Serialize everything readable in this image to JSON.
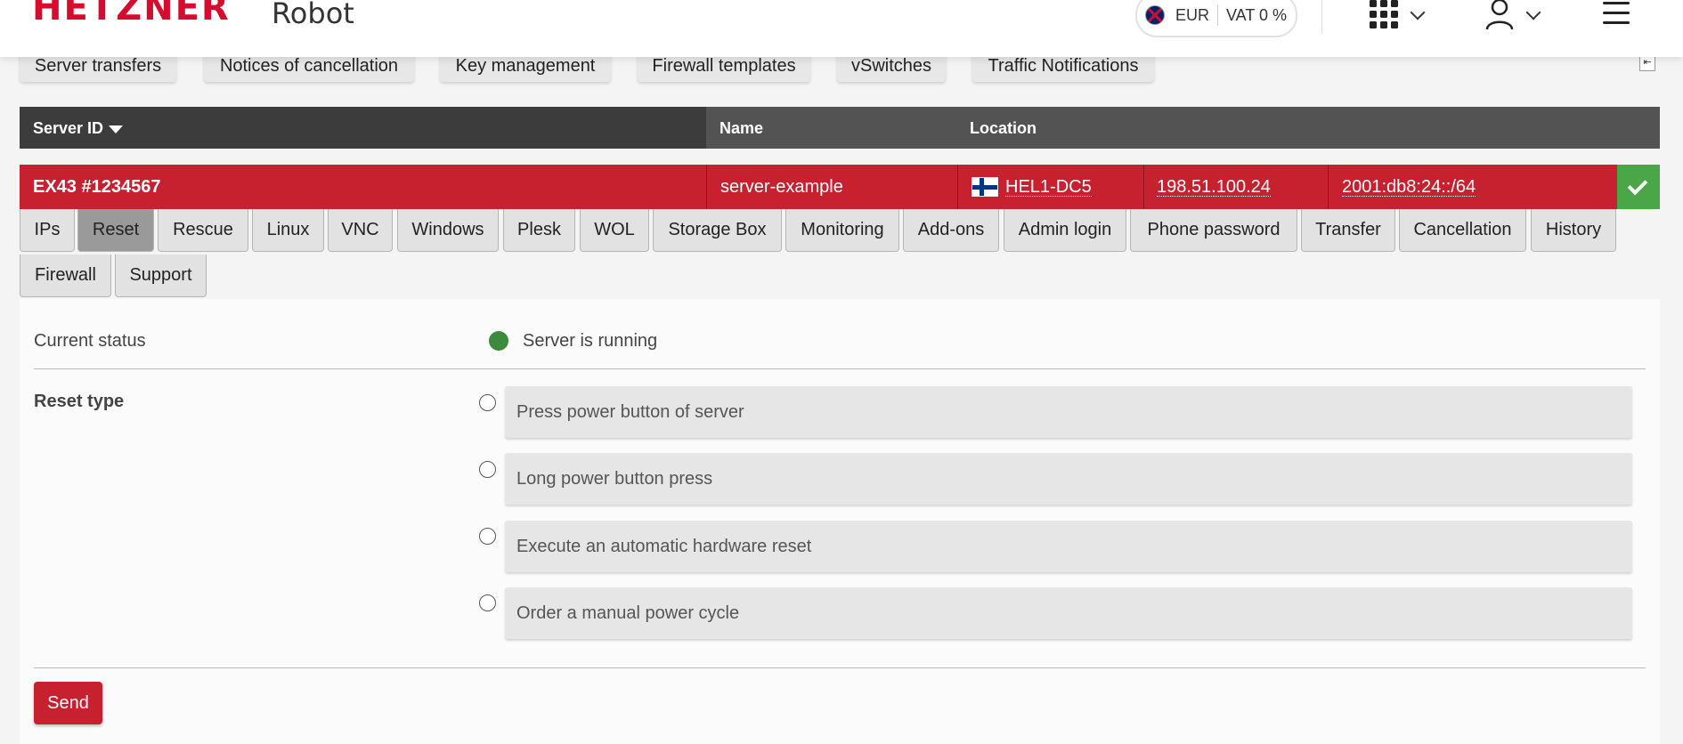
{
  "header": {
    "brand": "HETZNER",
    "product": "Robot",
    "currency": "EUR",
    "vat": "VAT 0 %",
    "locale_icon": "uk-flag-icon",
    "apps_icon": "grid-apps-icon",
    "user_icon": "user-icon",
    "menu_icon": "hamburger-menu-icon",
    "brand_color": "#d50c2d"
  },
  "subnav": {
    "items": [
      "Server transfers",
      "Notices of cancellation",
      "Key management",
      "Firewall templates",
      "vSwitches",
      "Traffic Notifications"
    ]
  },
  "table": {
    "columns": {
      "server_id": "Server ID",
      "name": "Name",
      "location": "Location"
    },
    "row": {
      "server_id": "EX43 #1234567",
      "name": "server-example",
      "location": "HEL1-DC5",
      "location_flag": "finland-flag-icon",
      "ipv4": "198.51.100.24",
      "ipv6": "2001:db8:24::/64",
      "status_icon": "checkmark-icon",
      "row_color": "#c7202f",
      "status_color": "#4aa647"
    }
  },
  "tabs": {
    "items": [
      "IPs",
      "Reset",
      "Rescue",
      "Linux",
      "VNC",
      "Windows",
      "Plesk",
      "WOL",
      "Storage Box",
      "Monitoring",
      "Add-ons",
      "Admin login",
      "Phone password",
      "Transfer",
      "Cancellation",
      "History",
      "Firewall",
      "Support"
    ],
    "active": "Reset"
  },
  "reset": {
    "status_label": "Current status",
    "status_value": "Server is running",
    "status_color": "#3c8a3c",
    "reset_type_label": "Reset type",
    "options": [
      "Press power button of server",
      "Long power button press",
      "Execute an automatic hardware reset",
      "Order a manual power cycle"
    ],
    "send_label": "Send"
  }
}
